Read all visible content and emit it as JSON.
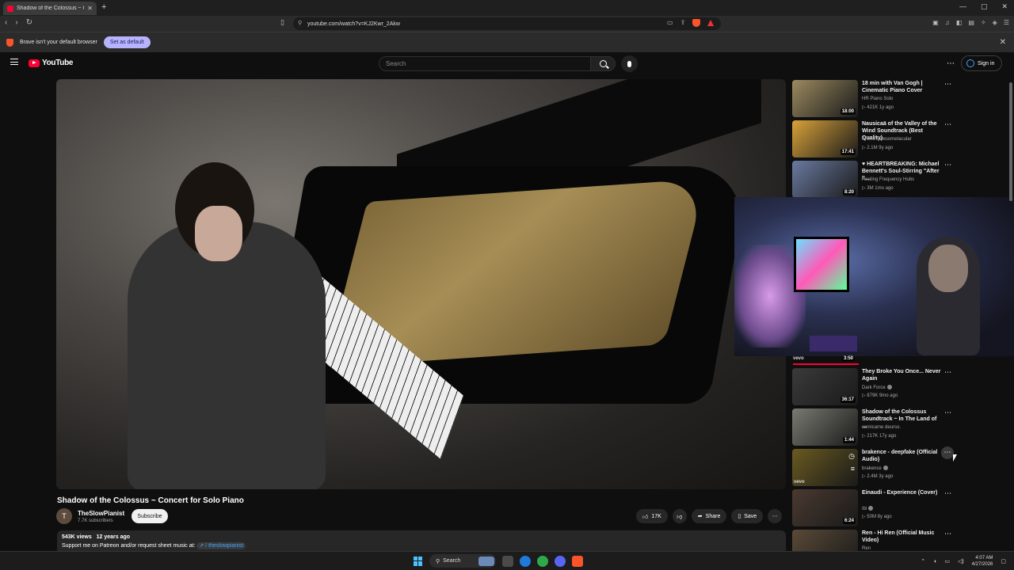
{
  "browser": {
    "tab_title": "Shadow of the Colossus ~ Co",
    "url": "youtube.com/watch?v=KJ2Kwr_2Akw",
    "notice_text": "Brave isn't your default browser",
    "notice_button": "Set as default"
  },
  "header": {
    "logo": "YouTube",
    "search_placeholder": "Search",
    "signin": "Sign in"
  },
  "video": {
    "title": "Shadow of the Colossus ~ Concert for Solo Piano",
    "channel": "TheSlowPianist",
    "channel_initial": "T",
    "subscribers": "7.7K subscribers",
    "subscribe": "Subscribe",
    "likes": "17K",
    "share": "Share",
    "save": "Save",
    "views": "543K views",
    "age": "12 years ago",
    "description": "Support me on Patreon and/or request sheet music at:",
    "desc_link": "/ theslowpianist"
  },
  "recommendations": [
    {
      "title": "18 min with Van Gogh | Cinematic Piano Cover",
      "channel": "HR Piano Solo",
      "stats": "▷ 421K  1y ago",
      "duration": "18:00",
      "thumb_color": "#9c8a60"
    },
    {
      "title": "Nausicaä of the Valley of the Wind Soundtrack (Best Quality)",
      "channel": "Anime Awesometacular",
      "stats": "▷ 2.1M  9y ago",
      "duration": "17:41",
      "thumb_color": "#d9a23a"
    },
    {
      "title": "♥ HEARTBREAKING: Michael Bennett's Soul-Stirring \"After I'...",
      "channel": "Healing Frequency Hubs",
      "stats": "▷ 3M  1mo ago",
      "duration": "8:20",
      "thumb_color": "#6a7aa0"
    },
    {
      "title": "They Broke You Once... Never Again",
      "channel": "Dark Force",
      "stats": "▷ 879K  9mo ago",
      "duration": "36:17",
      "thumb_color": "#3a3a3a"
    },
    {
      "title": "Shadow of the Colossus Soundtrack ~ In The Land of ...",
      "channel": "comicame deurso.",
      "stats": "▷ 217K  17y ago",
      "duration": "1:44",
      "thumb_color": "#7a7a72"
    },
    {
      "title": "brakence - deepfake (Official Audio)",
      "channel": "brakence",
      "stats": "▷ 2.4M  3y ago",
      "duration": "",
      "thumb_color": "#6a5a20"
    },
    {
      "title": "Einaudi - Experience (Cover)",
      "channel": "Ibi",
      "stats": "▷ 50M  8y ago",
      "duration": "6:24",
      "thumb_color": "#4a3a30"
    },
    {
      "title": "Ren - Hi Ren (Official Music Video)",
      "channel": "Ren",
      "stats": "",
      "duration": "",
      "thumb_color": "#5a4a38"
    }
  ],
  "hidden_rec_duration": "3:50",
  "vevo": "vevo",
  "taskbar": {
    "search": "Search",
    "time": "4:07 AM",
    "date": "4/27/2026"
  }
}
